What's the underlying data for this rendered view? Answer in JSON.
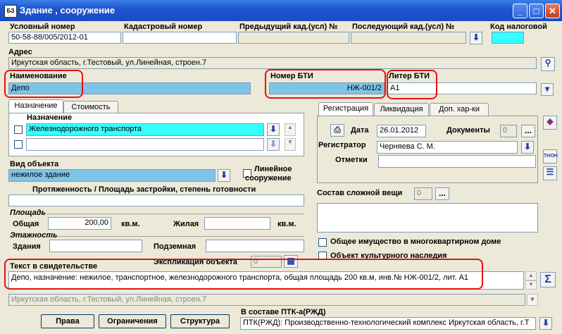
{
  "window": {
    "title": "Здание , сооружение",
    "title_icon": "БЗ"
  },
  "titlebar_buttons": {
    "minimize": "_",
    "maximize": "□",
    "close": "✕"
  },
  "header": {
    "cond_number_label": "Условный номер",
    "cond_number_value": "50-58-88/005/2012-01",
    "cadastral_label": "Кадастровый номер",
    "cadastral_value": "",
    "prev_cad_label": "Предыдущий кад.(усл) №",
    "prev_cad_value": "",
    "next_cad_label": "Последующий кад.(усл) №",
    "next_cad_value": "",
    "tax_code_label": "Код налоговой",
    "tax_code_value": ""
  },
  "address": {
    "label": "Адрес",
    "value": "Иркутская область, г.Тестовый, ул.Линейная, строен.7"
  },
  "name_block": {
    "label": "Наименование",
    "value": "Депо"
  },
  "bti": {
    "label": "Номер БТИ",
    "value": "НЖ-001/2"
  },
  "liter": {
    "label": "Литер БТИ",
    "value": "А1"
  },
  "left_tabs": [
    "Назначение",
    "Стоимость"
  ],
  "purpose": {
    "label": "Назначение",
    "row1": "Железнодорожного транспорта",
    "row2": ""
  },
  "object_kind": {
    "label": "Вид объекта",
    "value": "нежилое здание",
    "linear_label_1": "Линейное",
    "linear_label_2": "сооружение"
  },
  "extent": {
    "label": "Протяженность / Площадь застройки, степень готовности",
    "value": ""
  },
  "area": {
    "group_label": "Площадь",
    "total_label": "Общая",
    "total_value": "200,00",
    "unit1": "кв.м.",
    "living_label": "Жилая",
    "living_value": "",
    "unit2": "кв.м."
  },
  "floors": {
    "group_label": "Этажность",
    "buildings_label": "Здания",
    "buildings_value": "",
    "underground_label": "Подземная",
    "underground_value": ""
  },
  "explication": {
    "label": "Экспликация объекта",
    "value": "0"
  },
  "right_tabs": [
    "Регистрация",
    "Ликвидация",
    "Доп. хар-ки"
  ],
  "registration": {
    "date_label": "Дата",
    "date_value": "26.01.2012",
    "docs_label": "Документы",
    "docs_value": "0",
    "registrar_label": "Регистратор",
    "registrar_value": "Черняева С. М.",
    "notes_label": "Отметки",
    "notes_value": "",
    "ellipsis": "..."
  },
  "complex_thing": {
    "label": "Состав сложной вещи",
    "value": "0"
  },
  "checkboxes": {
    "common_property": "Общее имущество в многоквартирном доме",
    "cultural_heritage": "Объект культурного наследия"
  },
  "certificate": {
    "label": "Текст в свидетельстве",
    "value": "Депо, назначение: нежилое, транспортное, железнодорожного транспорта, общая площадь 200 кв.м, инв.№ НЖ-001/2, лит. А1",
    "sum_icon": "Σ"
  },
  "address_copy": {
    "value": "Иркутская область, г.Тестовый, ул.Линейная, строен.7"
  },
  "ptk": {
    "label": "В составе ПТК-а(РЖД)",
    "value": "ПТК(РЖД): Производственно-технологический комплекс Иркутская область, г.Т"
  },
  "buttons": {
    "rights": "Права",
    "restrictions": "Ограничения",
    "structure": "Структура"
  },
  "icons": {
    "down_arrow": "⬇",
    "side_icon_label": "ТНОН"
  },
  "colors": {
    "highlight_blue": "#7ec4e8",
    "cyan": "#35ffff",
    "red_annotation": "#e8110f",
    "titlebar": "#1f55cf"
  }
}
